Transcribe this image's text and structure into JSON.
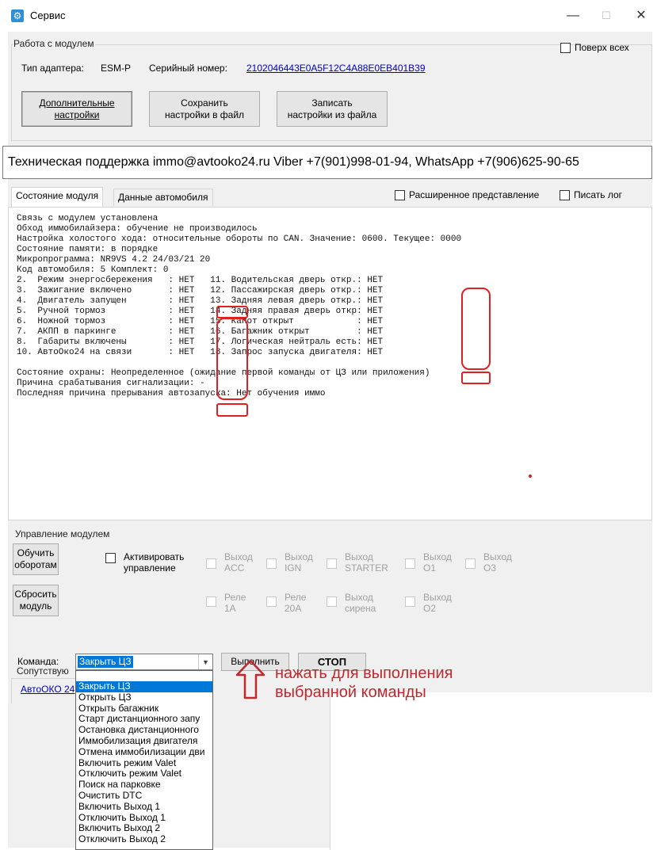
{
  "window": {
    "title": "Сервис",
    "min": "—",
    "max": "☐",
    "close": "✕"
  },
  "module_group": {
    "label": "Работа с модулем",
    "topmost_label": "Поверх всех",
    "adapter_type_label": "Тип адаптера:",
    "adapter_type_value": "ESM-P",
    "serial_label": "Серийный номер:",
    "serial_value": "2102046443E0A5F12C4A88E0EB401B39",
    "buttons": {
      "extra_settings": [
        "Дополнительные",
        "настройки"
      ],
      "save_settings": [
        "Сохранить",
        "настройки в файл"
      ],
      "load_settings": [
        "Записать",
        "настройки из файла"
      ]
    }
  },
  "support_text": "Техническая поддержка immo@avtooko24.ru    Viber +7(901)998-01-94, WhatsApp +7(906)625-90-65",
  "tabs": [
    {
      "label": "Состояние модуля"
    },
    {
      "label": "Данные автомобиля"
    }
  ],
  "options": {
    "extended_view": "Расширенное представление",
    "write_log": "Писать лог"
  },
  "status_text": "Связь с модулем установлена\nОбход иммобилайзера: обучение не производилось\nНастройка холостого хода: относительные обороты по CAN. Значение: 0600. Текущее: 0000\nСостояние памяти: в порядке\nМикропрограмма: NR9VS 4.2 24/03/21 20\nКод автомобиля: 5 Комплект: 0\n2.  Режим энергосбережения   : НЕТ   11. Водительская дверь откр.: НЕТ\n3.  Зажигание включено       : НЕТ   12. Пассажирская дверь откр.: НЕТ\n4.  Двигатель запущен        : НЕТ   13. Задняя левая дверь откр.: НЕТ\n5.  Ручной тормоз            : НЕТ   14. Задняя правая дверь откр: НЕТ\n6.  Ножной тормоз            : НЕТ   15. Капот открыт            : НЕТ\n7.  АКПП в паркинге          : НЕТ   16. Багажник открыт         : НЕТ\n8.  Габариты включены        : НЕТ   17. Логическая нейтраль есть: НЕТ\n10. АвтоОко24 на связи       : НЕТ   18. Запрос запуска двигателя: НЕТ\n\nСостояние охраны: Неопределенное (ожидание первой команды от ЦЗ или приложения)\nПричина срабатывания сигнализации: -\nПоследняя причина прерывания автозапуска: Нет обучения иммо",
  "control_group": {
    "label": "Управление модулем",
    "learn_rpm": [
      "Обучить",
      "оборотам"
    ],
    "reset_module": [
      "Сбросить",
      "модуль"
    ],
    "activate": [
      "Активировать",
      "управление"
    ],
    "outputs_row1": [
      [
        "Выход",
        "ACC"
      ],
      [
        "Выход",
        "IGN"
      ],
      [
        "Выход",
        "STARTER"
      ],
      [
        "Выход",
        "O1"
      ],
      [
        "Выход",
        "O3"
      ]
    ],
    "outputs_row2": [
      [
        "Реле",
        "1A"
      ],
      [
        "Реле",
        "20A"
      ],
      [
        "Выход",
        "сирена"
      ],
      [
        "Выход",
        "O2"
      ]
    ],
    "command_label": "Команда:",
    "command_value": "Закрыть ЦЗ",
    "execute": "Выполнить",
    "stop": "СТОП"
  },
  "related_label": "Сопутствую",
  "related_link": "АвтоОКО 24",
  "dropdown_items": [
    "Закрыть ЦЗ",
    "Открыть ЦЗ",
    "Открыть багажник",
    "Старт дистанционного запу",
    "Остановка дистанционного",
    "Иммобилизация двигателя",
    "Отмена иммобилизации дви",
    "Включить режим Valet",
    "Отключить режим Valet",
    "Поиск на парковке",
    "Очистить DTC",
    "Включить Выход 1",
    "Отключить Выход 1",
    "Включить Выход 2",
    "Отключить Выход 2"
  ],
  "annotation": [
    "нажать для выполнения",
    "выбранной команды"
  ],
  "colors": {
    "accent": "#0078d7",
    "annotation": "#c0282c",
    "link": "#0000cc"
  }
}
